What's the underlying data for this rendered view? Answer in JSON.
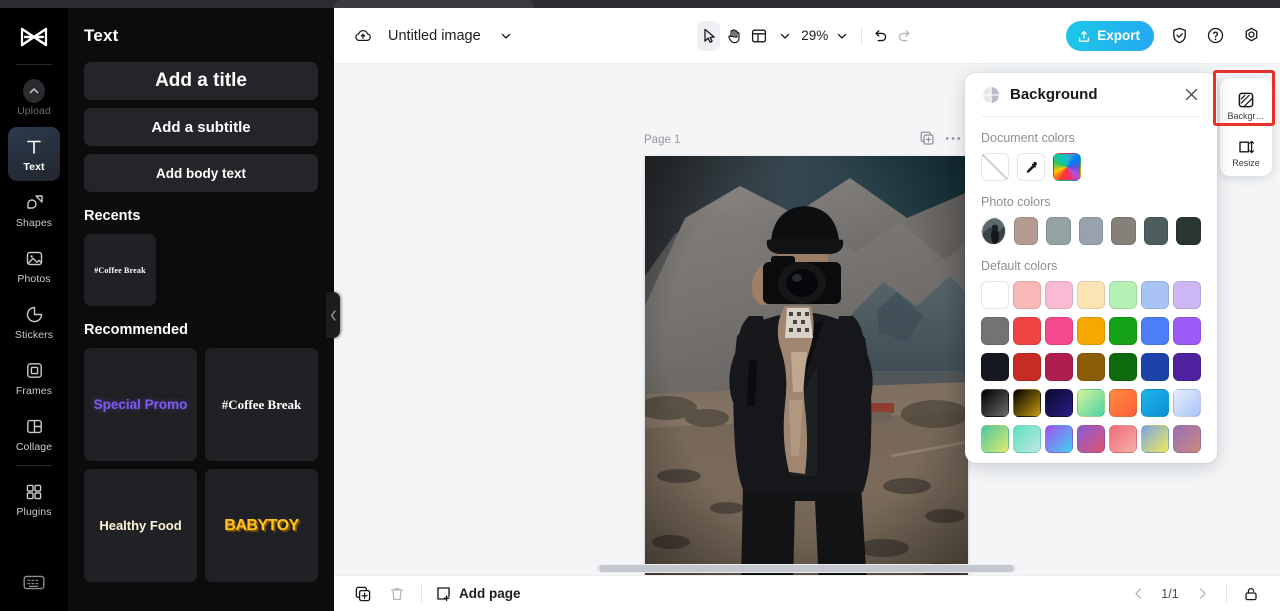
{
  "rail": {
    "logo_icon": "capcut-logo-icon",
    "items": [
      {
        "label": "Upload",
        "icon": "upload-icon",
        "active": false,
        "dim": true
      },
      {
        "label": "Text",
        "icon": "text-icon",
        "active": true,
        "dim": false
      },
      {
        "label": "Shapes",
        "icon": "shapes-icon",
        "active": false,
        "dim": false
      },
      {
        "label": "Photos",
        "icon": "photos-icon",
        "active": false,
        "dim": false
      },
      {
        "label": "Stickers",
        "icon": "stickers-icon",
        "active": false,
        "dim": false
      },
      {
        "label": "Frames",
        "icon": "frames-icon",
        "active": false,
        "dim": false
      },
      {
        "label": "Collage",
        "icon": "collage-icon",
        "active": false,
        "dim": false
      },
      {
        "label": "Plugins",
        "icon": "plugins-icon",
        "active": false,
        "dim": false
      }
    ],
    "bottom_icon": "keyboard-shortcuts-icon"
  },
  "panel": {
    "title": "Text",
    "add_buttons": [
      {
        "label": "Add a title"
      },
      {
        "label": "Add a subtitle"
      },
      {
        "label": "Add body text"
      }
    ],
    "recents_title": "Recents",
    "recents": [
      {
        "label": "#Coffee Break",
        "style": "coffee-sm"
      }
    ],
    "recommended_title": "Recommended",
    "recommended": [
      {
        "label": "Special Promo",
        "style": "promo"
      },
      {
        "label": "#Coffee Break",
        "style": "coffee"
      },
      {
        "label": "Healthy Food",
        "style": "healthy"
      },
      {
        "label": "BABYTOY",
        "style": "baby"
      }
    ],
    "collapse_icon": "chevron-left-icon"
  },
  "toolbar": {
    "cloud_icon": "cloud-save-icon",
    "doc_title": "Untitled image",
    "doc_dropdown_icon": "chevron-down-icon",
    "select_tool_icon": "cursor-select-icon",
    "hand_tool_icon": "hand-pan-icon",
    "layout_tool_icon": "layout-grid-icon",
    "layout_dropdown_icon": "chevron-down-icon",
    "zoom_level": "29%",
    "zoom_dropdown_icon": "chevron-down-icon",
    "undo_icon": "undo-icon",
    "redo_icon": "redo-icon",
    "export_label": "Export",
    "export_icon": "upload-export-icon",
    "shield_icon": "shield-check-icon",
    "help_icon": "help-circle-icon",
    "settings_icon": "settings-gear-icon",
    "accent_color": "#1ec8e8"
  },
  "canvas": {
    "page_label": "Page 1",
    "page_duplicate_icon": "duplicate-page-icon",
    "page_more_icon": "more-options-icon",
    "photo_alt": "photographer-with-camera-mountain-landscape"
  },
  "bottombar": {
    "duplicate_icon": "duplicate-icon",
    "delete_icon": "trash-icon",
    "add_page_label": "Add page",
    "add_page_icon": "add-page-icon",
    "prev_icon": "chevron-left-icon",
    "next_icon": "chevron-right-icon",
    "page_count": "1/1",
    "unlock_icon": "unlock-icon"
  },
  "background_panel": {
    "title": "Background",
    "header_icon": "background-contrast-icon",
    "close_icon": "close-icon",
    "document_colors_label": "Document colors",
    "document_colors": [
      {
        "name": "transparent-swatch",
        "kind": "transparent"
      },
      {
        "name": "eyedropper-swatch",
        "kind": "eyedropper"
      },
      {
        "name": "color-picker-swatch",
        "kind": "picker"
      }
    ],
    "photo_colors_label": "Photo colors",
    "photo_colors": [
      {
        "name": "photo-thumbnail-swatch",
        "kind": "thumb"
      },
      {
        "name": "photo-color-1",
        "hex": "#b49c93"
      },
      {
        "name": "photo-color-2",
        "hex": "#93a3a3"
      },
      {
        "name": "photo-color-3",
        "hex": "#97a2ae"
      },
      {
        "name": "photo-color-4",
        "hex": "#86807a"
      },
      {
        "name": "photo-color-5",
        "hex": "#4d5c5c"
      },
      {
        "name": "photo-color-6",
        "hex": "#2a3634"
      }
    ],
    "default_colors_label": "Default colors",
    "default_colors": [
      "#ffffff",
      "#f9b8b8",
      "#f9bbd4",
      "#fbe3b4",
      "#b5f0b5",
      "#a8c4f5",
      "#cdb8f5",
      "#737373",
      "#ef4444",
      "#f4498f",
      "#f7a800",
      "#16a31a",
      "#4d7ef7",
      "#9b5cf7",
      "#16181f",
      "#c62c23",
      "#ae1f4f",
      "#8a5d06",
      "#0d6b0d",
      "#1c43a8",
      "#4e219e",
      "linear-gradient(135deg,#000000 0%,#6b6b6b 100%)",
      "linear-gradient(135deg,#000000 0%,#c79a10 100%)",
      "linear-gradient(135deg,#0a0a2a 0%,#2a1e8c 100%)",
      "linear-gradient(135deg,#d6f39a 0%,#4ad4a6 100%)",
      "linear-gradient(135deg,#ff8a3d 0%,#ff5e3a 100%)",
      "linear-gradient(135deg,#1fb6e8 0%,#0b8fd6 100%)",
      "linear-gradient(135deg,#e6eeff 0%,#a9c4f5 100%)",
      "linear-gradient(135deg,#49c9a3 0%,#e4e86a 100%)",
      "linear-gradient(135deg,#5ee0c0 0%,#bfe8e0 100%)",
      "linear-gradient(135deg,#a34ff0 0%,#3fd4f0 100%)",
      "linear-gradient(135deg,#8a5cd6 0%,#e0536f 100%)",
      "linear-gradient(135deg,#f06a7a 0%,#f5b2a8 100%)",
      "linear-gradient(135deg,#7aa6e0 0%,#f2e85c 100%)",
      "linear-gradient(135deg,#9b6fb8 0%,#c98a7a 100%)"
    ]
  },
  "right_panel": {
    "items": [
      {
        "label": "Backgr…",
        "icon": "background-icon",
        "highlighted": true
      },
      {
        "label": "Resize",
        "icon": "resize-icon",
        "highlighted": false
      }
    ],
    "highlight_color": "#e8302a"
  }
}
